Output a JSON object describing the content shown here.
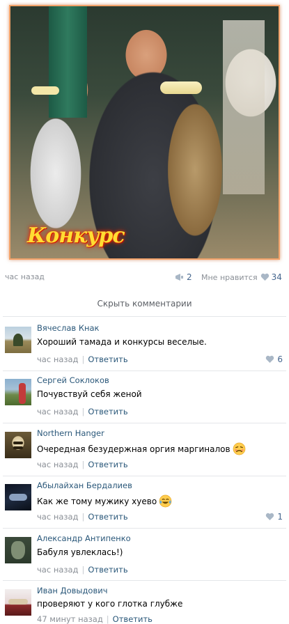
{
  "post": {
    "photo_caption": "Конкурс",
    "time": "час назад",
    "reposts": "2",
    "like_label": "Мне нравится",
    "likes": "34"
  },
  "hide_comments_label": "Скрыть комментарии",
  "reply_label": "Ответить",
  "comments": [
    {
      "author": "Вячеслав Кнак",
      "text": "Хороший тамада и конкурсы веселые.",
      "time": "час назад",
      "likes": "6",
      "emoji": ""
    },
    {
      "author": "Сергей Соклоков",
      "text": "Почувствуй себя женой",
      "time": "час назад",
      "likes": "",
      "emoji": ""
    },
    {
      "author": "Northern Hanger",
      "text": "Очередная безудержная оргия маргиналов",
      "time": "час назад",
      "likes": "",
      "emoji": "tired-face"
    },
    {
      "author": "Абылайхан Бердалиев",
      "text": "Как же тому мужику хуево",
      "time": "час назад",
      "likes": "1",
      "emoji": "tears-of-joy"
    },
    {
      "author": "Александр Антипенко",
      "text": "Бабуля увлеклась!)",
      "time": "час назад",
      "likes": "",
      "emoji": ""
    },
    {
      "author": "Иван Довыдович",
      "text": "проверяют у кого глотка глубже",
      "time": "47 минут назад",
      "likes": "",
      "emoji": ""
    }
  ],
  "colors": {
    "link": "#2b587a",
    "muted": "#8a8f96",
    "like_blue": "#45668e",
    "photo_border": "#f3a36a"
  }
}
